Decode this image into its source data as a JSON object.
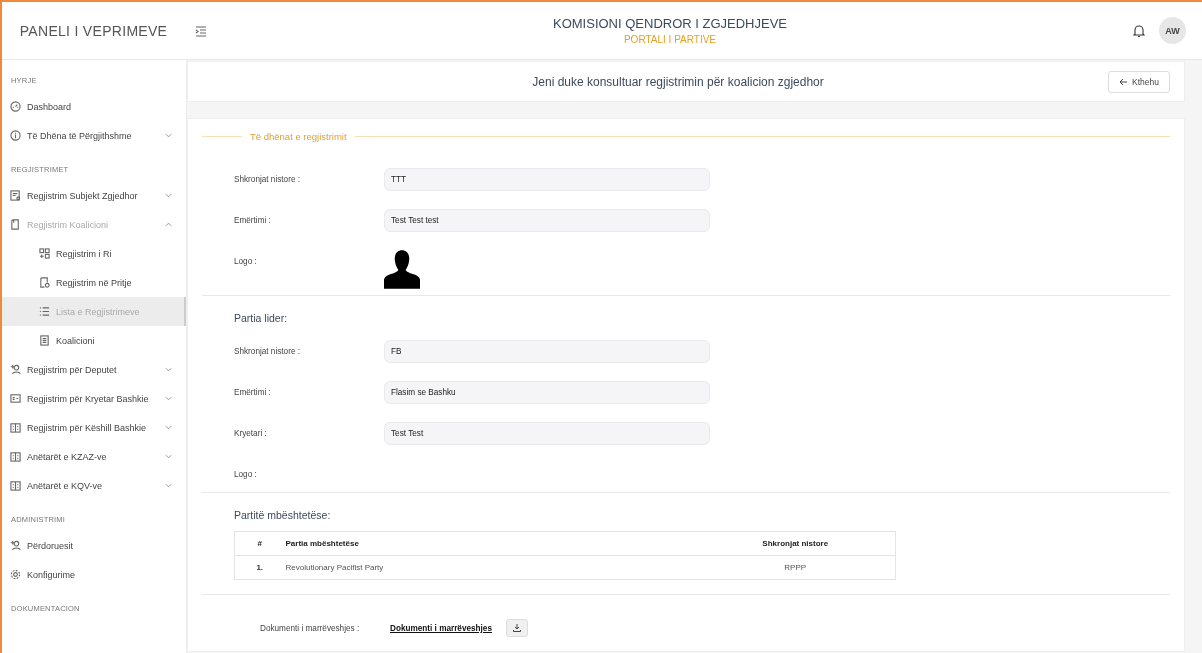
{
  "header": {
    "brand": "PANELI I VEPRIMEVE",
    "title": "KOMISIONI QENDROR I ZGJEDHJEVE",
    "subtitle": "PORTALI I PARTIVE",
    "avatar": "AW"
  },
  "sidebar": {
    "sections": [
      {
        "title": "HYRJE",
        "items": [
          {
            "label": "Dashboard",
            "selected": false
          },
          {
            "label": "Të Dhëna të Përgjithshme",
            "expanded": false,
            "selected": false
          }
        ]
      },
      {
        "title": "REGJISTRIMET",
        "items": [
          {
            "label": "Regjistrim Subjekt Zgjedhor",
            "expanded": false,
            "selected": false
          },
          {
            "label": "Regjistrim Koalicioni",
            "expanded": true,
            "selected": false,
            "children": [
              {
                "label": "Regjistrim i Ri",
                "selected": false
              },
              {
                "label": "Regjistrim në Pritje",
                "selected": false
              },
              {
                "label": "Lista e Regjistrimeve",
                "selected": true
              },
              {
                "label": "Koalicioni",
                "selected": false
              }
            ]
          },
          {
            "label": "Regjistrim për Deputet",
            "expanded": false,
            "selected": false
          },
          {
            "label": "Regjistrim për Kryetar Bashkie",
            "expanded": false,
            "selected": false
          },
          {
            "label": "Regjistrim për Këshill Bashkie",
            "expanded": false,
            "selected": false
          },
          {
            "label": "Anëtarët e KZAZ-ve",
            "expanded": false,
            "selected": false
          },
          {
            "label": "Anëtarët e KQV-ve",
            "expanded": false,
            "selected": false
          }
        ]
      },
      {
        "title": "ADMINISTRIMI",
        "items": [
          {
            "label": "Përdoruesit",
            "selected": false
          },
          {
            "label": "Konfigurime",
            "selected": false
          }
        ]
      },
      {
        "title": "DOKUMENTACION"
      }
    ]
  },
  "page_title": "Jeni duke konsultuar regjistrimin për koalicion zgjedhor",
  "back_button": "Kthehu",
  "legend": "Të dhënat e regjistrimit",
  "sections": [
    {
      "fields": [
        {
          "kind": "text",
          "label": "Shkronjat nistore :",
          "value": "TTT"
        },
        {
          "kind": "text",
          "label": "Emërtimi :",
          "value": "Test Test test"
        },
        {
          "kind": "logo",
          "label": "Logo :"
        }
      ]
    },
    {
      "heading": "Partia lider:",
      "fields": [
        {
          "kind": "text",
          "label": "Shkronjat nistore :",
          "value": "FB"
        },
        {
          "kind": "text",
          "label": "Emërtimi :",
          "value": "Flasim se Bashku"
        },
        {
          "kind": "text",
          "label": "Kryetari :",
          "value": "Test Test"
        },
        {
          "kind": "empty",
          "label": "Logo :"
        }
      ]
    }
  ],
  "supporting": {
    "heading": "Partitë mbështetëse:",
    "columns": [
      "#",
      "Partia mbështetëse",
      "Shkronjat nistore"
    ],
    "rows": [
      [
        "1.",
        "Revolutionary Pacifist Party",
        "RPPP"
      ]
    ]
  },
  "document": {
    "label": "Dokumenti i marrëveshjes :",
    "link": "Dokumenti i marrëveshjes"
  }
}
